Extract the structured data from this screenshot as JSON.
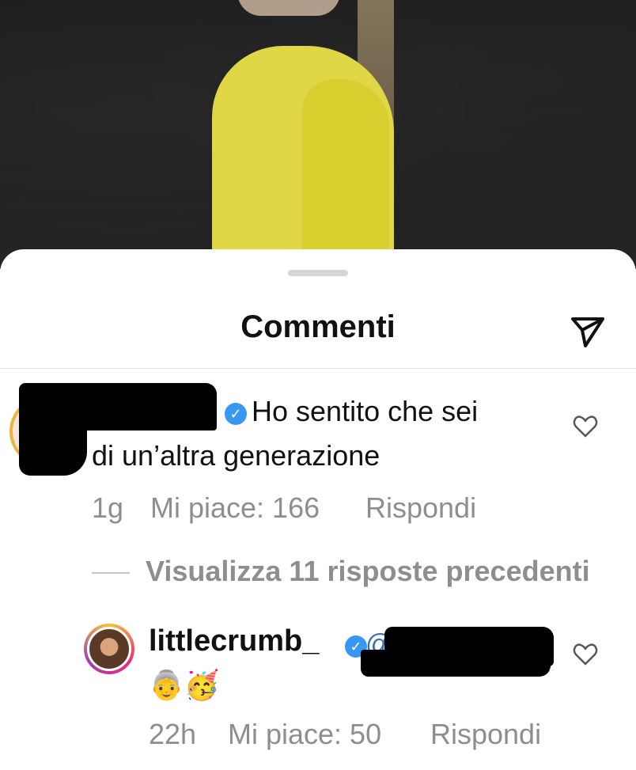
{
  "sheet": {
    "title": "Commenti",
    "share_icon": "paper-plane-icon"
  },
  "comments": [
    {
      "username": "",
      "verified": true,
      "text_line1": "Ho sentito che sei",
      "text_line2": "di un’altra generazione",
      "time": "1g",
      "likes": "Mi piace: 166",
      "reply": "Rispondi",
      "like_icon": "heart-icon"
    },
    {
      "username": "littlecrumb_",
      "verified": true,
      "mention": "@",
      "text": "👵🥳",
      "time": "22h",
      "likes": "Mi piace: 50",
      "reply": "Rispondi",
      "like_icon": "heart-icon"
    }
  ],
  "view_replies": "Visualizza 11 risposte precedenti",
  "colors": {
    "verified": "#3897f0",
    "meta_text": "#8e8e8e",
    "text": "#111111"
  }
}
